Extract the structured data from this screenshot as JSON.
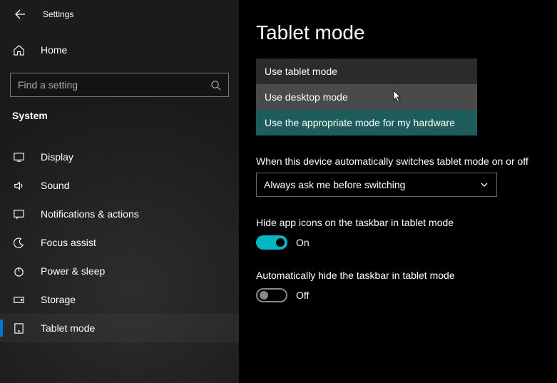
{
  "titlebar": {
    "title": "Settings"
  },
  "sidebar": {
    "home_label": "Home",
    "search_placeholder": "Find a setting",
    "section_label": "System",
    "items": [
      {
        "label": "Display"
      },
      {
        "label": "Sound"
      },
      {
        "label": "Notifications & actions"
      },
      {
        "label": "Focus assist"
      },
      {
        "label": "Power & sleep"
      },
      {
        "label": "Storage"
      },
      {
        "label": "Tablet mode"
      }
    ]
  },
  "main": {
    "title": "Tablet mode",
    "signin_dropdown": {
      "options": [
        "Use tablet mode",
        "Use desktop mode",
        "Use the appropriate mode for my hardware"
      ]
    },
    "switch_label": "When this device automatically switches tablet mode on or off",
    "switch_value": "Always ask me before switching",
    "hide_icons_label": "Hide app icons on the taskbar in tablet mode",
    "hide_icons_state": "On",
    "auto_hide_label": "Automatically hide the taskbar in tablet mode",
    "auto_hide_state": "Off"
  }
}
